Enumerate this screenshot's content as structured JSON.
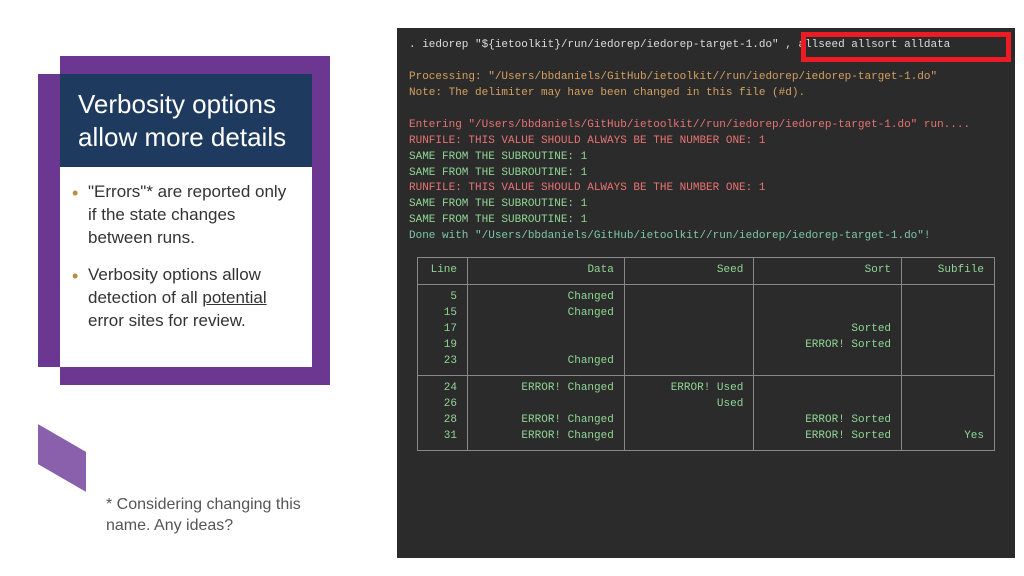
{
  "title": "Verbosity options allow more details",
  "bullets": {
    "b1a": "\"Errors\"* are reported only if the state changes between runs.",
    "b2a": "Verbosity options allow detection of all ",
    "b2b": "potential",
    "b2c": " error sites for review."
  },
  "footnote": "* Considering changing this name. Any ideas?",
  "terminal": {
    "cmd": ". iedorep \"${ietoolkit}/run/iedorep/iedorep-target-1.do\" , allseed allsort alldata",
    "processing": "Processing: \"/Users/bbdaniels/GitHub/ietoolkit//run/iedorep/iedorep-target-1.do\"",
    "note": "      Note: The delimiter may have been changed in this file (#d).",
    "entering": "Entering \"/Users/bbdaniels/GitHub/ietoolkit//run/iedorep/iedorep-target-1.do\" run....",
    "r1": "RUNFILE: THIS VALUE SHOULD ALWAYS BE THE NUMBER ONE: 1",
    "r2": "SAME FROM THE SUBROUTINE: 1",
    "r3": "SAME FROM THE SUBROUTINE: 1",
    "r4": "RUNFILE: THIS VALUE SHOULD ALWAYS BE THE NUMBER ONE: 1",
    "r5": "SAME FROM THE SUBROUTINE: 1",
    "r6": "SAME FROM THE SUBROUTINE: 1",
    "done": "Done with \"/Users/bbdaniels/GitHub/ietoolkit//run/iedorep/iedorep-target-1.do\"!"
  },
  "table": {
    "h1": "Line",
    "h2": "Data",
    "h3": "Seed",
    "h4": "Sort",
    "h5": "Subfile",
    "g1": {
      "lines": "5\n15\n17\n19\n23",
      "data": "Changed\nChanged\n\n\nChanged",
      "seed": "",
      "sort": "\n\nSorted\nERROR! Sorted\n",
      "sub": ""
    },
    "g2": {
      "lines": "24\n26\n28\n31",
      "data": "ERROR! Changed\n\nERROR! Changed\nERROR! Changed",
      "seed": "ERROR! Used\nUsed\n\n",
      "sort": "\n\nERROR! Sorted\nERROR! Sorted",
      "sub": "\n\n\nYes"
    }
  }
}
